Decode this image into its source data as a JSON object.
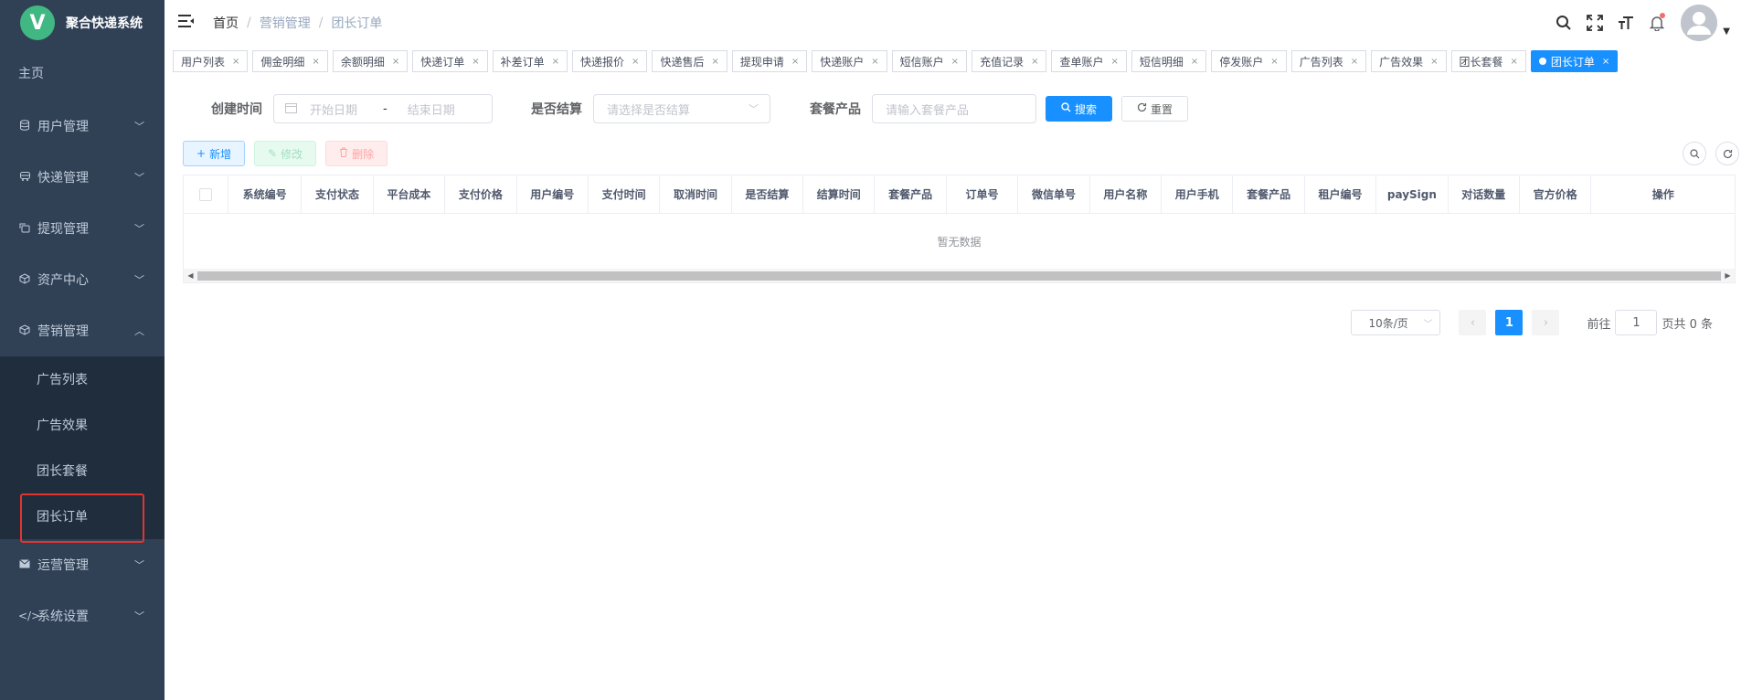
{
  "app": {
    "logo_letter": "V",
    "title": "聚合快递系统"
  },
  "sidebar": {
    "home": "主页",
    "items": [
      {
        "label": "用户管理",
        "icon": "database-icon"
      },
      {
        "label": "快递管理",
        "icon": "bus-icon"
      },
      {
        "label": "提现管理",
        "icon": "wallet-icon"
      },
      {
        "label": "资产中心",
        "icon": "box-icon"
      },
      {
        "label": "营销管理",
        "icon": "box-icon"
      }
    ],
    "submenu": [
      "广告列表",
      "广告效果",
      "团长套餐",
      "团长订单"
    ],
    "items_after": [
      {
        "label": "运营管理",
        "icon": "mail-icon"
      },
      {
        "label": "系统设置",
        "icon": "code-icon"
      }
    ]
  },
  "header": {
    "breadcrumb": [
      "首页",
      "营销管理",
      "团长订单"
    ],
    "separator": "/"
  },
  "tags": [
    "用户列表",
    "佣金明细",
    "余额明细",
    "快递订单",
    "补差订单",
    "快递报价",
    "快递售后",
    "提现申请",
    "快递账户",
    "短信账户",
    "充值记录",
    "查单账户",
    "短信明细",
    "停发账户",
    "广告列表",
    "广告效果",
    "团长套餐"
  ],
  "active_tag": "团长订单",
  "search": {
    "created_label": "创建时间",
    "start_placeholder": "开始日期",
    "range_sep": "-",
    "end_placeholder": "结束日期",
    "settled_label": "是否结算",
    "settled_placeholder": "请选择是否结算",
    "product_label": "套餐产品",
    "product_placeholder": "请输入套餐产品",
    "search_btn": "搜索",
    "reset_btn": "重置"
  },
  "toolbar": {
    "add": "新增",
    "edit": "修改",
    "delete": "删除"
  },
  "table": {
    "columns": [
      "系统编号",
      "支付状态",
      "平台成本",
      "支付价格",
      "用户编号",
      "支付时间",
      "取消时间",
      "是否结算",
      "结算时间",
      "套餐产品",
      "订单号",
      "微信单号",
      "用户名称",
      "用户手机",
      "套餐产品",
      "租户编号",
      "paySign",
      "对话数量",
      "官方价格",
      "操作"
    ],
    "empty_text": "暂无数据"
  },
  "pagination": {
    "page_size": "10条/页",
    "current_page": "1",
    "goto_label": "前往",
    "goto_value": "1",
    "total_text": "页共 0 条"
  },
  "colors": {
    "sidebar_bg": "#304156",
    "submenu_bg": "#1f2d3d",
    "primary": "#1890ff",
    "highlight": "#e3342f"
  }
}
